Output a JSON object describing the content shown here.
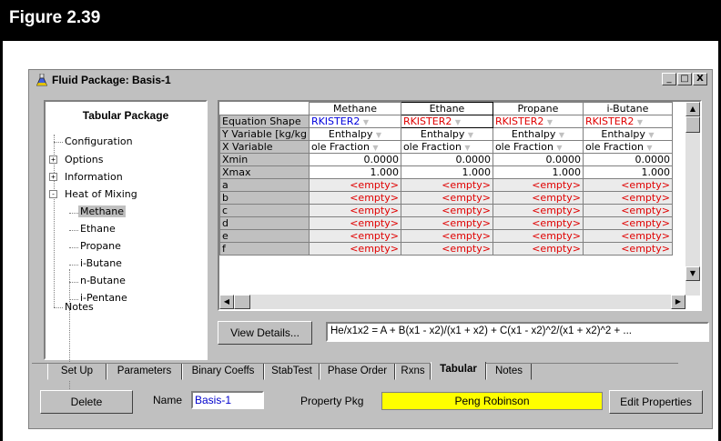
{
  "figure": {
    "title": "Figure 2.39"
  },
  "window": {
    "title": "Fluid Package: Basis-1",
    "controls": {
      "minimize": "_",
      "restore": "□",
      "close": "X"
    }
  },
  "tree": {
    "heading": "Tabular Package",
    "items": [
      {
        "label": "Configuration",
        "expander": ""
      },
      {
        "label": "Options",
        "expander": "+"
      },
      {
        "label": "Information",
        "expander": "+"
      },
      {
        "label": "Heat of Mixing",
        "expander": "-"
      },
      {
        "label": "Methane",
        "expander": ""
      },
      {
        "label": "Ethane",
        "expander": ""
      },
      {
        "label": "Propane",
        "expander": ""
      },
      {
        "label": "i-Butane",
        "expander": ""
      },
      {
        "label": "n-Butane",
        "expander": ""
      },
      {
        "label": "i-Pentane",
        "expander": ""
      },
      {
        "label": "Notes",
        "expander": ""
      }
    ],
    "selected": "Methane"
  },
  "grid": {
    "columns": [
      "Methane",
      "Ethane",
      "Propane",
      "i-Butane"
    ],
    "selected_column": "Ethane",
    "rows": [
      {
        "label": "Equation Shape",
        "cells": [
          "RKISTER2",
          "RKISTER2",
          "RKISTER2",
          "RKISTER2"
        ]
      },
      {
        "label": "Y Variable [kg/kg",
        "cells": [
          "Enthalpy",
          "Enthalpy",
          "Enthalpy",
          "Enthalpy"
        ]
      },
      {
        "label": "X Variable",
        "cells": [
          "ole Fraction",
          "ole Fraction",
          "ole Fraction",
          "ole Fraction"
        ]
      },
      {
        "label": "Xmin",
        "cells": [
          "0.0000",
          "0.0000",
          "0.0000",
          "0.0000"
        ]
      },
      {
        "label": "Xmax",
        "cells": [
          "1.000",
          "1.000",
          "1.000",
          "1.000"
        ]
      },
      {
        "label": "a",
        "cells": [
          "<empty>",
          "<empty>",
          "<empty>",
          "<empty>"
        ]
      },
      {
        "label": "b",
        "cells": [
          "<empty>",
          "<empty>",
          "<empty>",
          "<empty>"
        ]
      },
      {
        "label": "c",
        "cells": [
          "<empty>",
          "<empty>",
          "<empty>",
          "<empty>"
        ]
      },
      {
        "label": "d",
        "cells": [
          "<empty>",
          "<empty>",
          "<empty>",
          "<empty>"
        ]
      },
      {
        "label": "e",
        "cells": [
          "<empty>",
          "<empty>",
          "<empty>",
          "<empty>"
        ]
      },
      {
        "label": "f",
        "cells": [
          "<empty>",
          "<empty>",
          "<empty>",
          "<empty>"
        ]
      }
    ],
    "colors": {
      "blue_text": "#0000dd",
      "red_text": "#e00000"
    }
  },
  "view_details": {
    "label": "View Details...",
    "accel": "V"
  },
  "equation": "He/x1x2 = A + B(x1 - x2)/(x1 + x2) + C(x1 - x2)^2/(x1 + x2)^2 + ...",
  "tabs": [
    "Set Up",
    "Parameters",
    "Binary Coeffs",
    "StabTest",
    "Phase Order",
    "Rxns",
    "Tabular",
    "Notes"
  ],
  "active_tab": "Tabular",
  "bottom": {
    "delete_label": "Delete",
    "name_label": "Name",
    "name_value": "Basis-1",
    "property_pkg_label": "Property Pkg",
    "property_pkg_value": "Peng Robinson",
    "edit_properties_label": "Edit Properties",
    "pkg_color": "#ffff00"
  }
}
